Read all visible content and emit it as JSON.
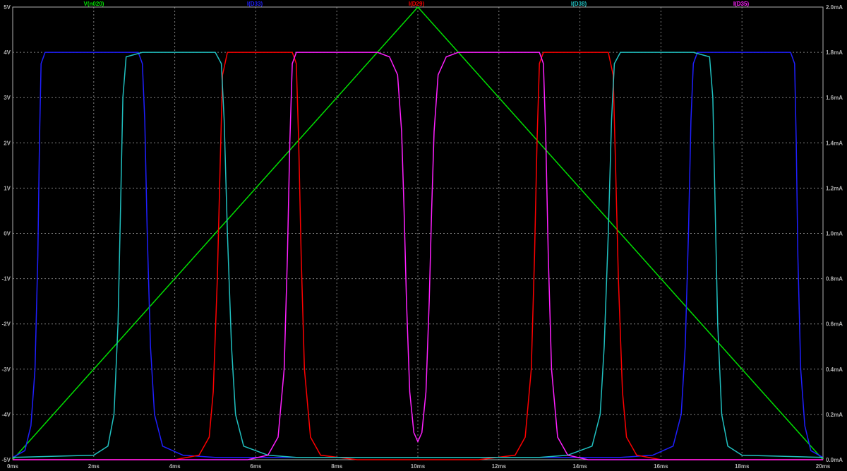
{
  "chart_data": {
    "type": "line",
    "background": "#000000",
    "grid": true,
    "grid_color": "#7f7f7f",
    "axis_color": "#b0b0b0",
    "x": {
      "unit": "ms",
      "range": [
        0,
        20
      ],
      "ticks": [
        0,
        2,
        4,
        6,
        8,
        10,
        12,
        14,
        16,
        18,
        20
      ],
      "tick_labels": [
        "0ms",
        "2ms",
        "4ms",
        "6ms",
        "8ms",
        "10ms",
        "12ms",
        "14ms",
        "16ms",
        "18ms",
        "20ms"
      ]
    },
    "y_left": {
      "unit": "V",
      "range": [
        -5,
        5
      ],
      "ticks": [
        -5,
        -4,
        -3,
        -2,
        -1,
        0,
        1,
        2,
        3,
        4,
        5
      ],
      "tick_labels": [
        "-5V",
        "-4V",
        "-3V",
        "-2V",
        "-1V",
        "0V",
        "1V",
        "2V",
        "3V",
        "4V",
        "5V"
      ]
    },
    "y_right": {
      "unit": "mA",
      "range": [
        0,
        2.0
      ],
      "ticks": [
        0,
        0.2,
        0.4,
        0.6,
        0.8,
        1.0,
        1.2,
        1.4,
        1.6,
        1.8,
        2.0
      ],
      "tick_labels": [
        "0.0mA",
        "0.2mA",
        "0.4mA",
        "0.6mA",
        "0.8mA",
        "1.0mA",
        "1.2mA",
        "1.4mA",
        "1.6mA",
        "1.8mA",
        "2.0mA"
      ]
    },
    "series": [
      {
        "name": "V(n020)",
        "axis": "left",
        "color": "#00e000",
        "points": [
          [
            0,
            -5
          ],
          [
            10,
            5
          ],
          [
            20,
            -5
          ]
        ]
      },
      {
        "name": "I(D33)",
        "axis": "right",
        "color": "#1f1fff",
        "points": [
          [
            0,
            0.01
          ],
          [
            0.3,
            0.04
          ],
          [
            0.45,
            0.15
          ],
          [
            0.55,
            0.4
          ],
          [
            0.62,
            0.9
          ],
          [
            0.66,
            1.4
          ],
          [
            0.7,
            1.75
          ],
          [
            0.8,
            1.8
          ],
          [
            2.8,
            1.8
          ],
          [
            3.1,
            1.8
          ],
          [
            3.2,
            1.75
          ],
          [
            3.26,
            1.5
          ],
          [
            3.32,
            1.0
          ],
          [
            3.4,
            0.5
          ],
          [
            3.5,
            0.2
          ],
          [
            3.7,
            0.06
          ],
          [
            4.2,
            0.02
          ],
          [
            5,
            0.01
          ],
          [
            15,
            0.01
          ],
          [
            15.8,
            0.02
          ],
          [
            16.3,
            0.06
          ],
          [
            16.5,
            0.2
          ],
          [
            16.6,
            0.5
          ],
          [
            16.68,
            1.0
          ],
          [
            16.74,
            1.5
          ],
          [
            16.8,
            1.75
          ],
          [
            16.9,
            1.8
          ],
          [
            19.2,
            1.8
          ],
          [
            19.3,
            1.75
          ],
          [
            19.34,
            1.4
          ],
          [
            19.38,
            0.9
          ],
          [
            19.45,
            0.4
          ],
          [
            19.55,
            0.15
          ],
          [
            19.7,
            0.04
          ],
          [
            20,
            0.01
          ]
        ]
      },
      {
        "name": "I(D29)",
        "axis": "right",
        "color": "#ff0000",
        "points": [
          [
            0,
            0.0
          ],
          [
            4.0,
            0.0
          ],
          [
            4.6,
            0.02
          ],
          [
            4.85,
            0.1
          ],
          [
            4.95,
            0.3
          ],
          [
            5.05,
            0.8
          ],
          [
            5.12,
            1.3
          ],
          [
            5.18,
            1.7
          ],
          [
            5.3,
            1.8
          ],
          [
            6.9,
            1.8
          ],
          [
            7.0,
            1.75
          ],
          [
            7.06,
            1.4
          ],
          [
            7.12,
            0.9
          ],
          [
            7.2,
            0.4
          ],
          [
            7.35,
            0.1
          ],
          [
            7.6,
            0.02
          ],
          [
            8.5,
            0.0
          ],
          [
            11.5,
            0.0
          ],
          [
            12.4,
            0.02
          ],
          [
            12.65,
            0.1
          ],
          [
            12.8,
            0.4
          ],
          [
            12.88,
            0.9
          ],
          [
            12.94,
            1.4
          ],
          [
            13.0,
            1.75
          ],
          [
            13.1,
            1.8
          ],
          [
            14.7,
            1.8
          ],
          [
            14.82,
            1.7
          ],
          [
            14.88,
            1.3
          ],
          [
            14.95,
            0.8
          ],
          [
            15.05,
            0.3
          ],
          [
            15.15,
            0.1
          ],
          [
            15.4,
            0.02
          ],
          [
            16.0,
            0.0
          ],
          [
            20,
            0.0
          ]
        ]
      },
      {
        "name": "I(D38)",
        "axis": "right",
        "color": "#20c0c0",
        "points": [
          [
            0,
            0.01
          ],
          [
            2.0,
            0.02
          ],
          [
            2.35,
            0.06
          ],
          [
            2.5,
            0.2
          ],
          [
            2.6,
            0.6
          ],
          [
            2.66,
            1.1
          ],
          [
            2.72,
            1.6
          ],
          [
            2.8,
            1.78
          ],
          [
            3.2,
            1.8
          ],
          [
            5.0,
            1.8
          ],
          [
            5.15,
            1.75
          ],
          [
            5.22,
            1.5
          ],
          [
            5.3,
            1.0
          ],
          [
            5.4,
            0.5
          ],
          [
            5.5,
            0.2
          ],
          [
            5.7,
            0.06
          ],
          [
            6.3,
            0.02
          ],
          [
            7.0,
            0.01
          ],
          [
            13.0,
            0.01
          ],
          [
            13.7,
            0.02
          ],
          [
            14.3,
            0.06
          ],
          [
            14.5,
            0.2
          ],
          [
            14.6,
            0.5
          ],
          [
            14.7,
            1.0
          ],
          [
            14.78,
            1.5
          ],
          [
            14.85,
            1.75
          ],
          [
            15.0,
            1.8
          ],
          [
            16.8,
            1.8
          ],
          [
            17.2,
            1.78
          ],
          [
            17.28,
            1.6
          ],
          [
            17.34,
            1.1
          ],
          [
            17.4,
            0.6
          ],
          [
            17.5,
            0.2
          ],
          [
            17.65,
            0.06
          ],
          [
            18.0,
            0.02
          ],
          [
            20,
            0.01
          ]
        ]
      },
      {
        "name": "I(D35)",
        "axis": "right",
        "color": "#ff20ff",
        "points": [
          [
            0,
            0.0
          ],
          [
            5.8,
            0.0
          ],
          [
            6.3,
            0.02
          ],
          [
            6.55,
            0.1
          ],
          [
            6.7,
            0.4
          ],
          [
            6.78,
            0.9
          ],
          [
            6.84,
            1.4
          ],
          [
            6.9,
            1.75
          ],
          [
            7.0,
            1.8
          ],
          [
            9.0,
            1.8
          ],
          [
            9.3,
            1.78
          ],
          [
            9.5,
            1.7
          ],
          [
            9.6,
            1.45
          ],
          [
            9.66,
            1.1
          ],
          [
            9.72,
            0.7
          ],
          [
            9.8,
            0.3
          ],
          [
            9.9,
            0.12
          ],
          [
            10.0,
            0.08
          ],
          [
            10.1,
            0.12
          ],
          [
            10.2,
            0.3
          ],
          [
            10.28,
            0.7
          ],
          [
            10.34,
            1.1
          ],
          [
            10.4,
            1.45
          ],
          [
            10.5,
            1.7
          ],
          [
            10.7,
            1.78
          ],
          [
            11.0,
            1.8
          ],
          [
            13.0,
            1.8
          ],
          [
            13.1,
            1.75
          ],
          [
            13.16,
            1.4
          ],
          [
            13.22,
            0.9
          ],
          [
            13.3,
            0.4
          ],
          [
            13.45,
            0.1
          ],
          [
            13.7,
            0.02
          ],
          [
            14.2,
            0.0
          ],
          [
            20,
            0.0
          ]
        ]
      }
    ]
  }
}
